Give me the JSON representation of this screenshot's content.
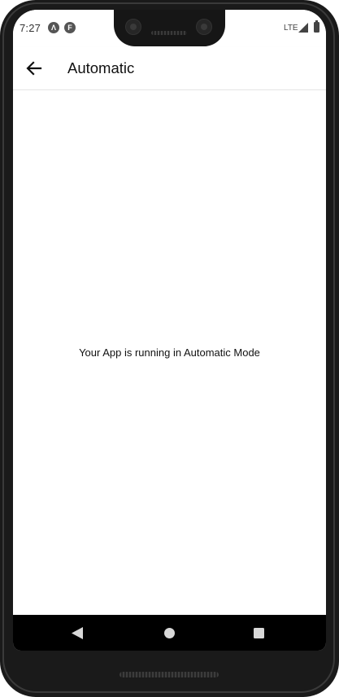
{
  "status_bar": {
    "time": "7:27",
    "app_icons": [
      {
        "name": "expo-icon",
        "glyph": "Λ"
      },
      {
        "name": "flutter-app-icon",
        "glyph": "F"
      }
    ],
    "network": "LTE",
    "signal_icon": "cell-signal-icon",
    "battery_icon": "battery-icon"
  },
  "app_bar": {
    "back_icon": "arrow-back-icon",
    "title": "Automatic"
  },
  "content": {
    "message": "Your App is running in Automatic Mode"
  },
  "nav_bar": {
    "back_icon": "triangle-back-icon",
    "home_icon": "circle-home-icon",
    "recents_icon": "square-recents-icon"
  },
  "colors": {
    "frame": "#1a1a1a",
    "screen_bg": "#ffffff",
    "nav_bar_bg": "#000000",
    "text": "#111111"
  }
}
